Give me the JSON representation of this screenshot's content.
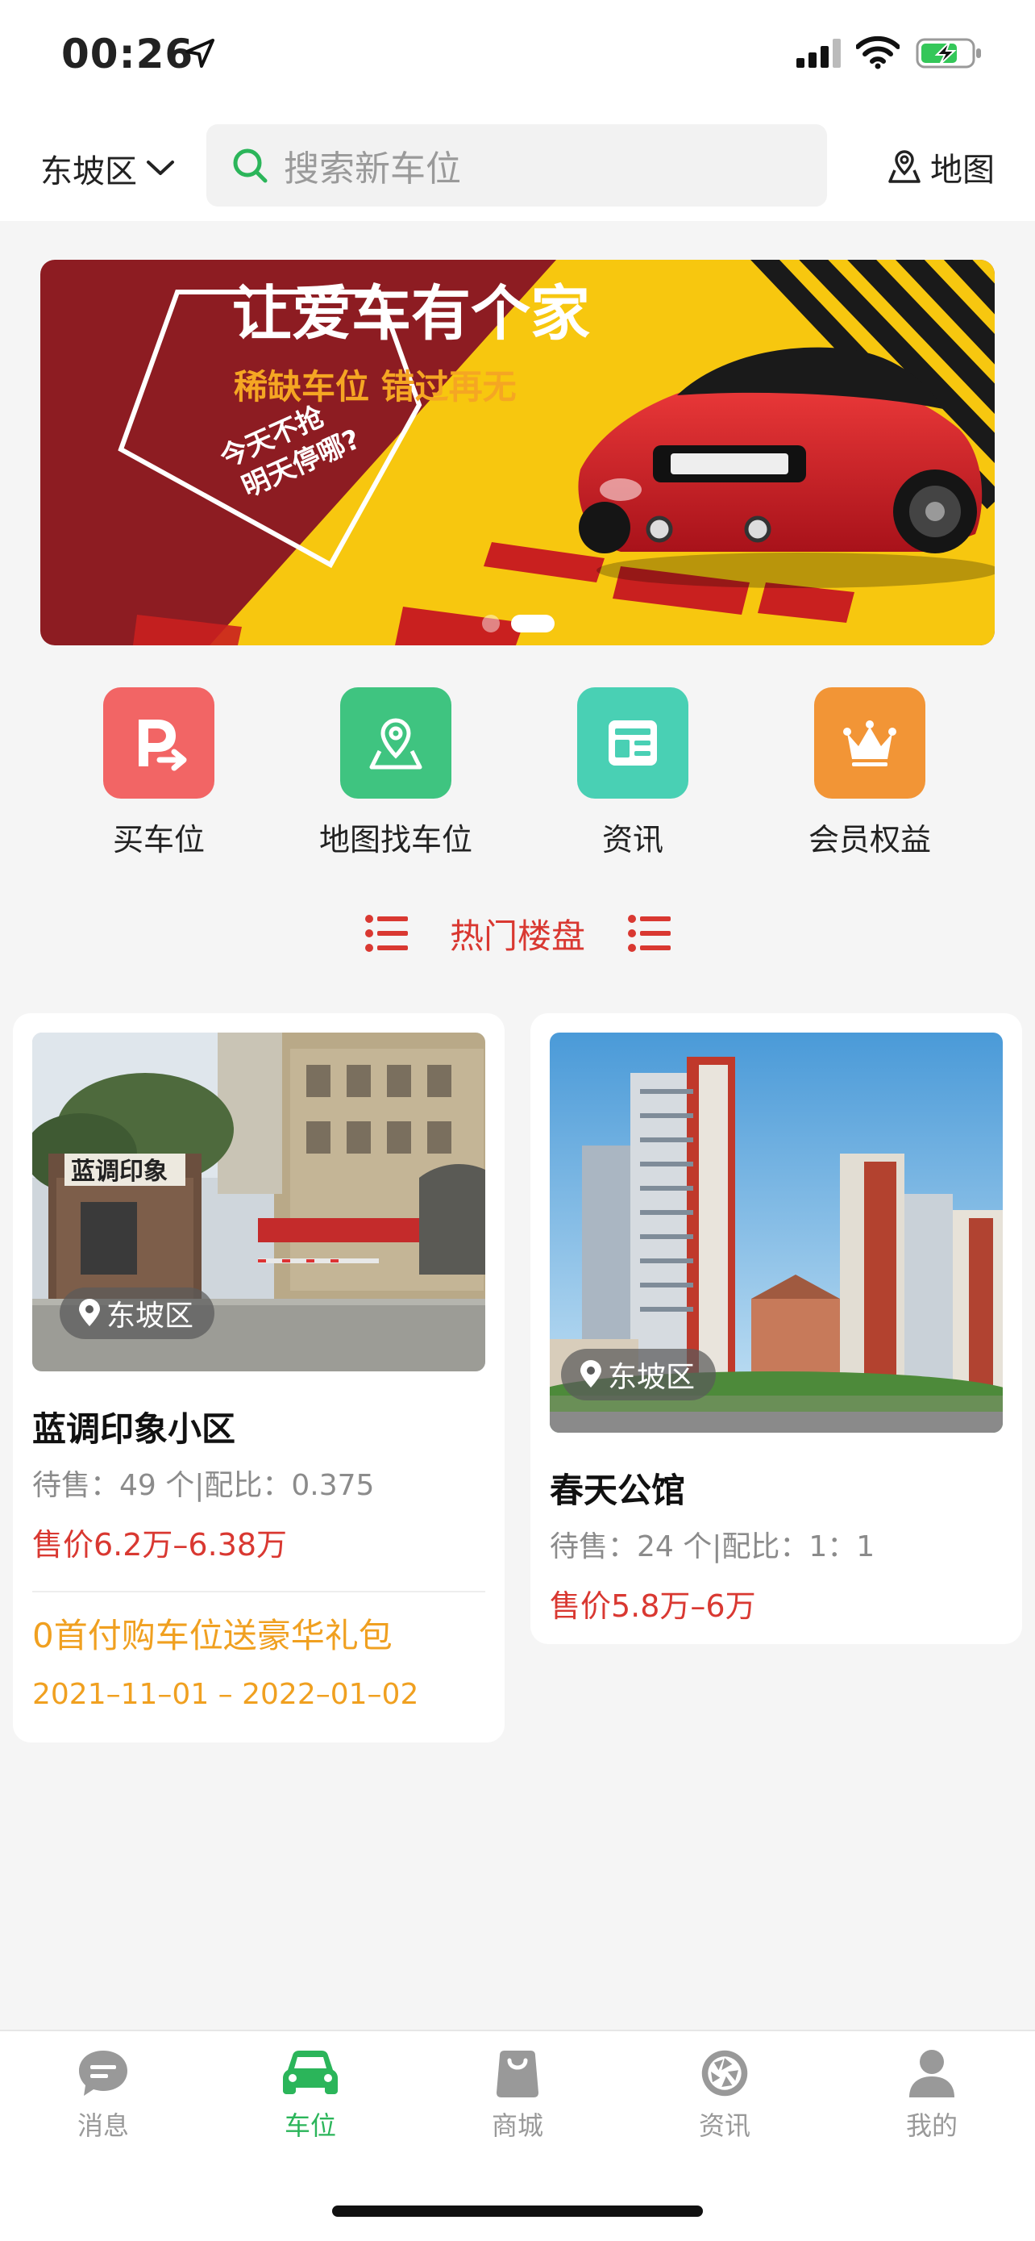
{
  "status_bar": {
    "time": "00:26"
  },
  "header": {
    "district": "东坡区",
    "search_placeholder": "搜索新车位",
    "map_label": "地图"
  },
  "banner": {
    "headline": "让爱车有个家",
    "subline": "稀缺车位 错过再无",
    "stamp_line1": "今天不抢",
    "stamp_line2": "明天停哪?",
    "slides": 2,
    "active_slide": 2
  },
  "entries": [
    {
      "label": "买车位",
      "icon": "parking-icon",
      "color": "#f26565"
    },
    {
      "label": "地图找车位",
      "icon": "map-pin-icon",
      "color": "#3fc480"
    },
    {
      "label": "资讯",
      "icon": "news-icon",
      "color": "#49d0b4"
    },
    {
      "label": "会员权益",
      "icon": "crown-icon",
      "color": "#f29536"
    }
  ],
  "hot_section": {
    "title": "热门楼盘"
  },
  "listings": [
    {
      "district": "东坡区",
      "name": "蓝调印象小区",
      "info": "待售：49 个|配比：0.375",
      "price": "售价6.2万–6.38万",
      "promo": "0首付购车位送豪华礼包",
      "dates": "2021–11–01 – 2022–01–02",
      "sign_text": "蓝调印象"
    },
    {
      "district": "东坡区",
      "name": "春天公馆",
      "info": "待售：24 个|配比：1：1",
      "price": "售价5.8万–6万"
    }
  ],
  "tabbar": [
    {
      "label": "消息",
      "icon": "message-icon",
      "active": false
    },
    {
      "label": "车位",
      "icon": "car-icon",
      "active": true
    },
    {
      "label": "商城",
      "icon": "shopping-bag-icon",
      "active": false
    },
    {
      "label": "资讯",
      "icon": "aperture-icon",
      "active": false
    },
    {
      "label": "我的",
      "icon": "person-icon",
      "active": false
    }
  ],
  "colors": {
    "accent": "#2bb55a",
    "price": "#d93831",
    "promo": "#f0a020"
  }
}
